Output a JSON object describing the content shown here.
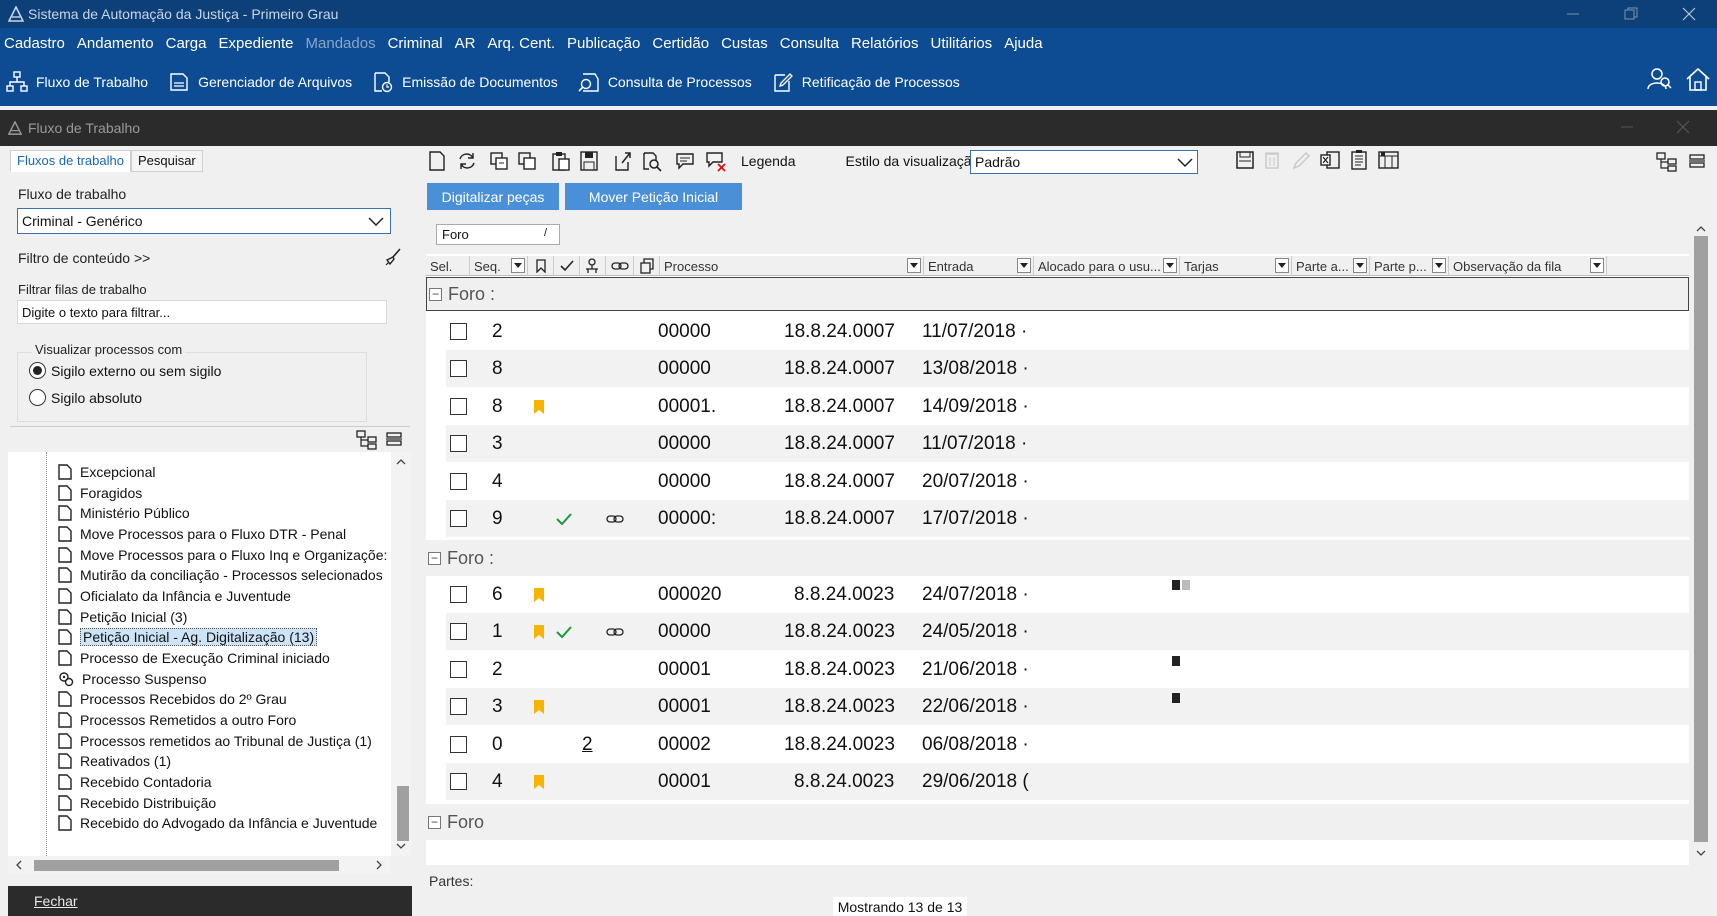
{
  "window": {
    "title": "Sistema de Automação da Justiça - Primeiro Grau"
  },
  "menu": [
    {
      "label": "Cadastro",
      "disabled": false
    },
    {
      "label": "Andamento",
      "disabled": false
    },
    {
      "label": "Carga",
      "disabled": false
    },
    {
      "label": "Expediente",
      "disabled": false
    },
    {
      "label": "Mandados",
      "disabled": true
    },
    {
      "label": "Criminal",
      "disabled": false
    },
    {
      "label": "AR",
      "disabled": false
    },
    {
      "label": "Arq. Cent.",
      "disabled": false
    },
    {
      "label": "Publicação",
      "disabled": false
    },
    {
      "label": "Certidão",
      "disabled": false
    },
    {
      "label": "Custas",
      "disabled": false
    },
    {
      "label": "Consulta",
      "disabled": false
    },
    {
      "label": "Relatórios",
      "disabled": false
    },
    {
      "label": "Utilitários",
      "disabled": false
    },
    {
      "label": "Ajuda",
      "disabled": false
    }
  ],
  "toolbar": [
    {
      "label": "Fluxo de Trabalho",
      "icon": "workflow-icon"
    },
    {
      "label": "Gerenciador de Arquivos",
      "icon": "file-manager-icon"
    },
    {
      "label": "Emissão de Documentos",
      "icon": "document-issue-icon"
    },
    {
      "label": "Consulta de Processos",
      "icon": "search-process-icon"
    },
    {
      "label": "Retificação de Processos",
      "icon": "edit-process-icon"
    }
  ],
  "inner_window": {
    "title": "Fluxo de Trabalho"
  },
  "left": {
    "tabs": [
      "Fluxos de trabalho",
      "Pesquisar"
    ],
    "workflow_label": "Fluxo de trabalho",
    "workflow_value": "Criminal - Genérico",
    "content_filter": "Filtro de conteúdo >>",
    "queue_filter_label": "Filtrar filas de trabalho",
    "queue_filter_placeholder": "Digite o texto para filtrar...",
    "view_group_label": "Visualizar processos com",
    "radio_external": "Sigilo externo ou sem sigilo",
    "radio_absolute": "Sigilo absoluto",
    "tree": [
      {
        "label": "Excepcional",
        "icon": "queue-icon"
      },
      {
        "label": "Foragidos",
        "icon": "queue-icon"
      },
      {
        "label": "Ministério Público",
        "icon": "queue-icon"
      },
      {
        "label": "Move Processos para o Fluxo DTR - Penal",
        "icon": "queue-icon"
      },
      {
        "label": "Move Processos para o Fluxo Inq e Organizaçõe:",
        "icon": "queue-icon"
      },
      {
        "label": "Mutirão da conciliação - Processos selecionados",
        "icon": "queue-icon"
      },
      {
        "label": "Oficialato da Infância e Juventude",
        "icon": "queue-icon"
      },
      {
        "label": "Petição Inicial (3)",
        "icon": "queue-icon"
      },
      {
        "label": "Petição Inicial - Ag. Digitalização (13)",
        "icon": "queue-icon",
        "selected": true
      },
      {
        "label": "Processo de Execução Criminal iniciado",
        "icon": "queue-icon"
      },
      {
        "label": "Processo Suspenso",
        "icon": "gears-icon"
      },
      {
        "label": "Processos Recebidos do 2º Grau",
        "icon": "queue-icon"
      },
      {
        "label": "Processos Remetidos a outro Foro",
        "icon": "queue-icon"
      },
      {
        "label": "Processos remetidos ao Tribunal de Justiça (1)",
        "icon": "queue-icon"
      },
      {
        "label": "Reativados (1)",
        "icon": "queue-icon"
      },
      {
        "label": "Recebido Contadoria",
        "icon": "queue-icon"
      },
      {
        "label": "Recebido Distribuição",
        "icon": "queue-icon"
      },
      {
        "label": "Recebido do Advogado da Infância e Juventude",
        "icon": "queue-icon"
      }
    ],
    "close_label": "Fechar"
  },
  "right": {
    "legend_label": "Legenda",
    "view_style_label": "Estilo da visualização",
    "view_style_value": "Padrão",
    "btn_digitalize": "Digitalizar peças",
    "btn_move": "Mover Petição Inicial",
    "group_chip": "Foro",
    "group_chip_sort": "/",
    "headers": [
      "Sel.",
      "Seq.",
      "Processo",
      "Entrada",
      "Alocado para o usu...",
      "Tarjas",
      "Parte a...",
      "Parte p...",
      "Observação da fila"
    ],
    "groups": [
      {
        "label": "Foro :",
        "rows": [
          {
            "seq": "2",
            "flag": false,
            "check": false,
            "link": false,
            "proc_a": "00000",
            "proc_b": "18.8.24.0007",
            "entry": "11/07/2018 ·"
          },
          {
            "seq": "8",
            "flag": false,
            "check": false,
            "link": false,
            "proc_a": "00000",
            "proc_b": "18.8.24.0007",
            "entry": "13/08/2018 ·"
          },
          {
            "seq": "8",
            "flag": true,
            "check": false,
            "link": false,
            "proc_a": "00001.",
            "proc_b": "18.8.24.0007",
            "entry": "14/09/2018 ·"
          },
          {
            "seq": "3",
            "flag": false,
            "check": false,
            "link": false,
            "proc_a": "00000",
            "proc_b": "18.8.24.0007",
            "entry": "11/07/2018 ·"
          },
          {
            "seq": "4",
            "flag": false,
            "check": false,
            "link": false,
            "proc_a": "00000",
            "proc_b": "18.8.24.0007",
            "entry": "20/07/2018 ·"
          },
          {
            "seq": "9",
            "flag": false,
            "check": true,
            "link": true,
            "proc_a": "00000:",
            "proc_b": "18.8.24.0007",
            "entry": "17/07/2018 ·"
          }
        ]
      },
      {
        "label": "Foro :",
        "rows": [
          {
            "seq": "6",
            "flag": true,
            "check": false,
            "link": false,
            "proc_a": "000020",
            "proc_b": "8.8.24.0023",
            "entry": "24/07/2018 ·"
          },
          {
            "seq": "1",
            "flag": true,
            "check": true,
            "link": true,
            "proc_a": "00000",
            "proc_b": "18.8.24.0023",
            "entry": "24/05/2018 ·"
          },
          {
            "seq": "2",
            "flag": false,
            "check": false,
            "link": false,
            "proc_a": "00001",
            "proc_b": "18.8.24.0023",
            "entry": "21/06/2018 ·"
          },
          {
            "seq": "3",
            "flag": true,
            "check": false,
            "link": false,
            "proc_a": "00001",
            "proc_b": "18.8.24.0023",
            "entry": "22/06/2018 ·"
          },
          {
            "seq": "0",
            "flag": false,
            "check": false,
            "link": false,
            "count": "2",
            "proc_a": "00002",
            "proc_b": "18.8.24.0023",
            "entry": "06/08/2018 ·"
          },
          {
            "seq": "4",
            "flag": true,
            "check": false,
            "link": false,
            "proc_a": "00001",
            "proc_b": "8.8.24.0023",
            "entry": "29/06/2018 ("
          }
        ]
      },
      {
        "label": "Foro",
        "rows": []
      }
    ],
    "parties_label": "Partes:",
    "status": "Mostrando 13 de 13"
  },
  "colors": {
    "title_bar": "#0d3f78",
    "menu_bar": "#0d4c92",
    "accent_button": "#4a90d9",
    "flag": "#f5b400",
    "check": "#1a9a3a"
  }
}
